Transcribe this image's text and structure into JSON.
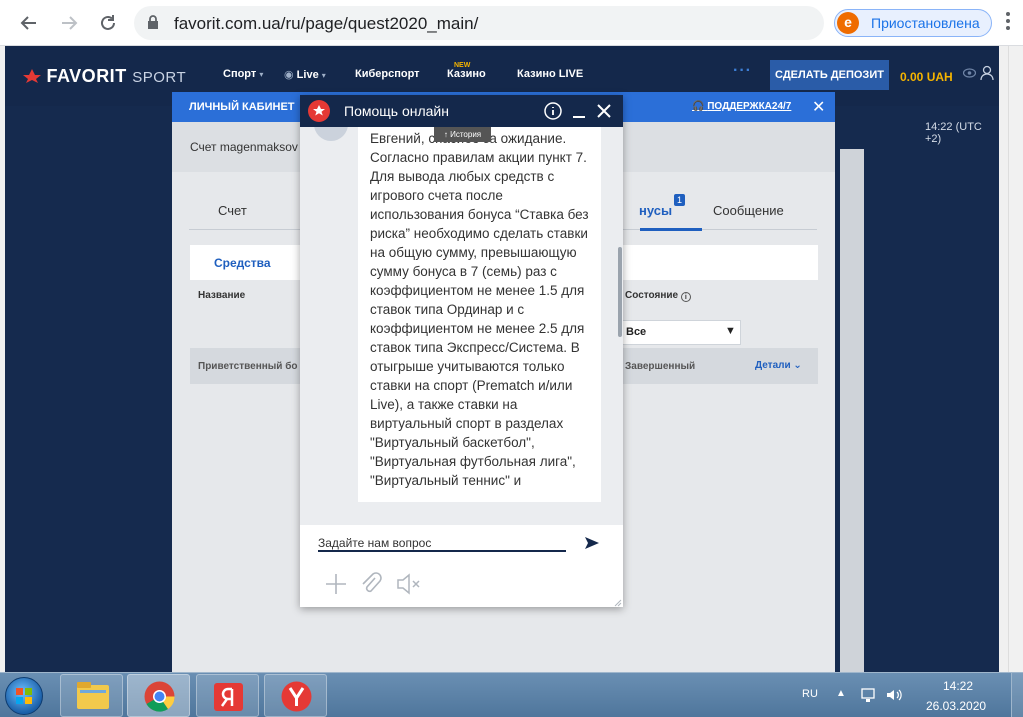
{
  "browser": {
    "url": "favorit.com.ua/ru/page/quest2020_main/",
    "profile_initial": "e",
    "profile_label": "Приостановлена"
  },
  "site": {
    "logo_main": "FAVORIT",
    "logo_sub": "SPORT",
    "nav": [
      "Спорт",
      "Live",
      "Киберспорт",
      "Казино",
      "Казино LIVE"
    ],
    "nav_new_badge": "NEW",
    "deposit_button": "СДЕЛАТЬ ДЕПОЗИТ",
    "balance": "0.00 UAH",
    "time": "14:22 (UTC +2)"
  },
  "cabinet": {
    "title": "ЛИЧНЫЙ КАБИНЕТ",
    "support_link": "ПОДДЕРЖКА24/7",
    "account_line": "Счет magenmaksov",
    "tabs": [
      "Счет",
      "нусы",
      "Сообщение"
    ],
    "tab_badge": "1",
    "subtab_funds": "Средства",
    "col_name": "Название",
    "col_status": "Состояние",
    "status_select_value": "Все",
    "row_name": "Приветственный бо",
    "row_status": "Завершенный",
    "row_details": "Детали"
  },
  "chat": {
    "title": "Помощь онлайн",
    "history_tip": "↑ История",
    "message": "Евгений, спасибо за ожидание. Согласно правилам акции пункт 7. Для вывода любых средств с игрового счета после использования бонуса “Ставка без риска” необходимо сделать ставки на общую сумму, превышающую сумму бонуса в 7 (семь) раз с коэффициентом не менее 1.5 для ставок типа Ординар и с коэффициентом не менее 2.5 для ставок типа Экспресс/Система. В отыгрыше учитываются только ставки на спорт (Prematch и/или Live), а также ставки на виртуальный спорт в разделах \"Виртуальный баскетбол\", \"Виртуальная футбольная лига\", \"Виртуальный теннис\" и",
    "input_placeholder": "Задайте нам вопрос"
  },
  "taskbar": {
    "lang": "RU",
    "time": "14:22",
    "date": "26.03.2020"
  },
  "colors": {
    "site_navy": "#14284b",
    "accent_blue": "#2b6fd8",
    "balance_yellow": "#f5b400",
    "logo_red": "#e53935"
  }
}
